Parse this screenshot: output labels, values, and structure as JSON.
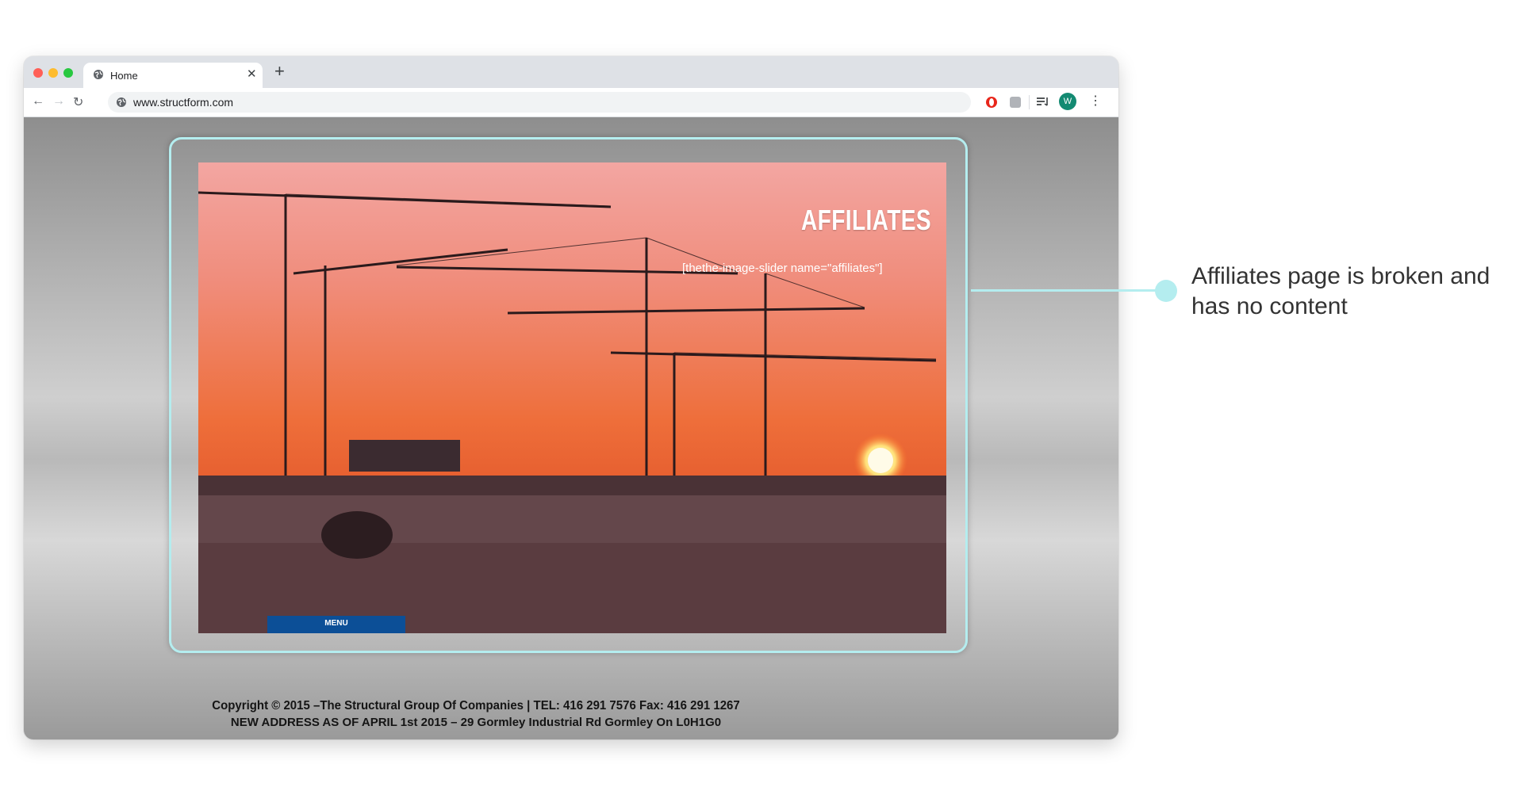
{
  "browser": {
    "tab": {
      "title": "Home"
    },
    "new_tab_label": "+",
    "close_label": "✕",
    "address_bar": {
      "url": "www.structform.com"
    },
    "profile_initial": "W"
  },
  "page": {
    "title": "AFFILIATES",
    "shortcode": "[thethe-image-slider name=\"affiliates\"]",
    "menu_label": "MENU",
    "footer_line1": "Copyright © 2015 –The Structural Group Of Companies |  TEL: 416 291 7576 Fax: 416 291 1267",
    "footer_line2": "NEW ADDRESS AS OF APRIL 1st 2015 – 29 Gormley Industrial Rd Gormley On L0H1G0"
  },
  "annotation": {
    "text": "Affiliates page is broken and has no content"
  },
  "colors": {
    "highlight": "#b4edef",
    "menu_bar": "#0c4f97"
  }
}
